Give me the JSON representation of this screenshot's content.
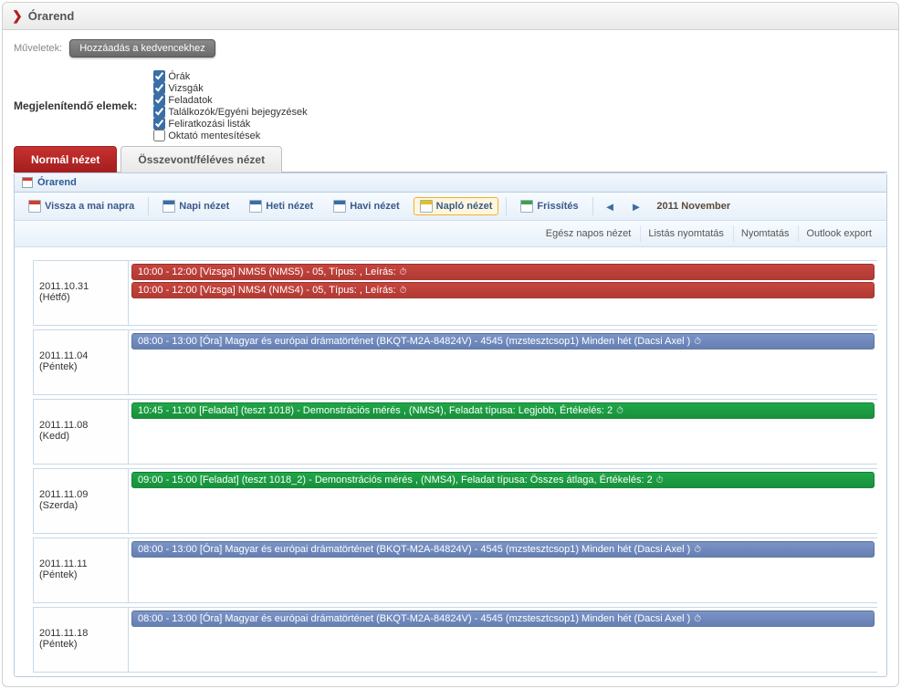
{
  "header": {
    "title": "Órarend"
  },
  "actions": {
    "label": "Műveletek:",
    "add_fav": "Hozzáadás a kedvencekhez"
  },
  "filters": {
    "label": "Megjelenítendő elemek:",
    "items": [
      {
        "label": "Órák",
        "checked": true
      },
      {
        "label": "Vizsgák",
        "checked": true
      },
      {
        "label": "Feladatok",
        "checked": true
      },
      {
        "label": "Találkozók/Egyéni bejegyzések",
        "checked": true
      },
      {
        "label": "Feliratkozási listák",
        "checked": true
      },
      {
        "label": "Oktató mentesítések",
        "checked": false
      }
    ]
  },
  "tabs": {
    "normal": "Normál nézet",
    "merged": "Összevont/féléves nézet"
  },
  "subpanel": {
    "title": "Órarend"
  },
  "toolbar": {
    "today": "Vissza a mai napra",
    "day": "Napi nézet",
    "week": "Heti nézet",
    "month": "Havi nézet",
    "log": "Napló nézet",
    "refresh": "Frissítés",
    "period": "2011 November"
  },
  "toolbar2": {
    "allday": "Egész napos nézet",
    "listprint": "Listás nyomtatás",
    "print": "Nyomtatás",
    "outlook": "Outlook export"
  },
  "rows": [
    {
      "date": "2011.10.31",
      "day": "(Hétfő)",
      "events": [
        {
          "color": "red",
          "text": "10:00 - 12:00 [Vizsga] NMS5 (NMS5) - 05, Típus: , Leírás: "
        },
        {
          "color": "red",
          "text": "10:00 - 12:00 [Vizsga] NMS4 (NMS4) - 05, Típus: , Leírás: "
        }
      ]
    },
    {
      "date": "2011.11.04",
      "day": "(Péntek)",
      "events": [
        {
          "color": "blue",
          "text": "08:00 - 13:00 [Óra] Magyar és európai drámatörténet (BKQT-M2A-84824V) - 4545 (mzstesztcsop1) Minden hét (Dacsi Axel )"
        }
      ]
    },
    {
      "date": "2011.11.08",
      "day": "(Kedd)",
      "events": [
        {
          "color": "green",
          "text": "10:45 - 11:00 [Feladat] (teszt 1018) - Demonstrációs mérés , (NMS4), Feladat típusa: Legjobb, Értékelés: 2"
        }
      ]
    },
    {
      "date": "2011.11.09",
      "day": "(Szerda)",
      "events": [
        {
          "color": "green",
          "text": "09:00 - 15:00 [Feladat] (teszt 1018_2) - Demonstrációs mérés , (NMS4), Feladat típusa: Összes átlaga, Értékelés: 2"
        }
      ]
    },
    {
      "date": "2011.11.11",
      "day": "(Péntek)",
      "events": [
        {
          "color": "blue",
          "text": "08:00 - 13:00 [Óra] Magyar és európai drámatörténet (BKQT-M2A-84824V) - 4545 (mzstesztcsop1) Minden hét (Dacsi Axel )"
        }
      ]
    },
    {
      "date": "2011.11.18",
      "day": "(Péntek)",
      "events": [
        {
          "color": "blue",
          "text": "08:00 - 13:00 [Óra] Magyar és európai drámatörténet (BKQT-M2A-84824V) - 4545 (mzstesztcsop1) Minden hét (Dacsi Axel )"
        }
      ]
    }
  ]
}
